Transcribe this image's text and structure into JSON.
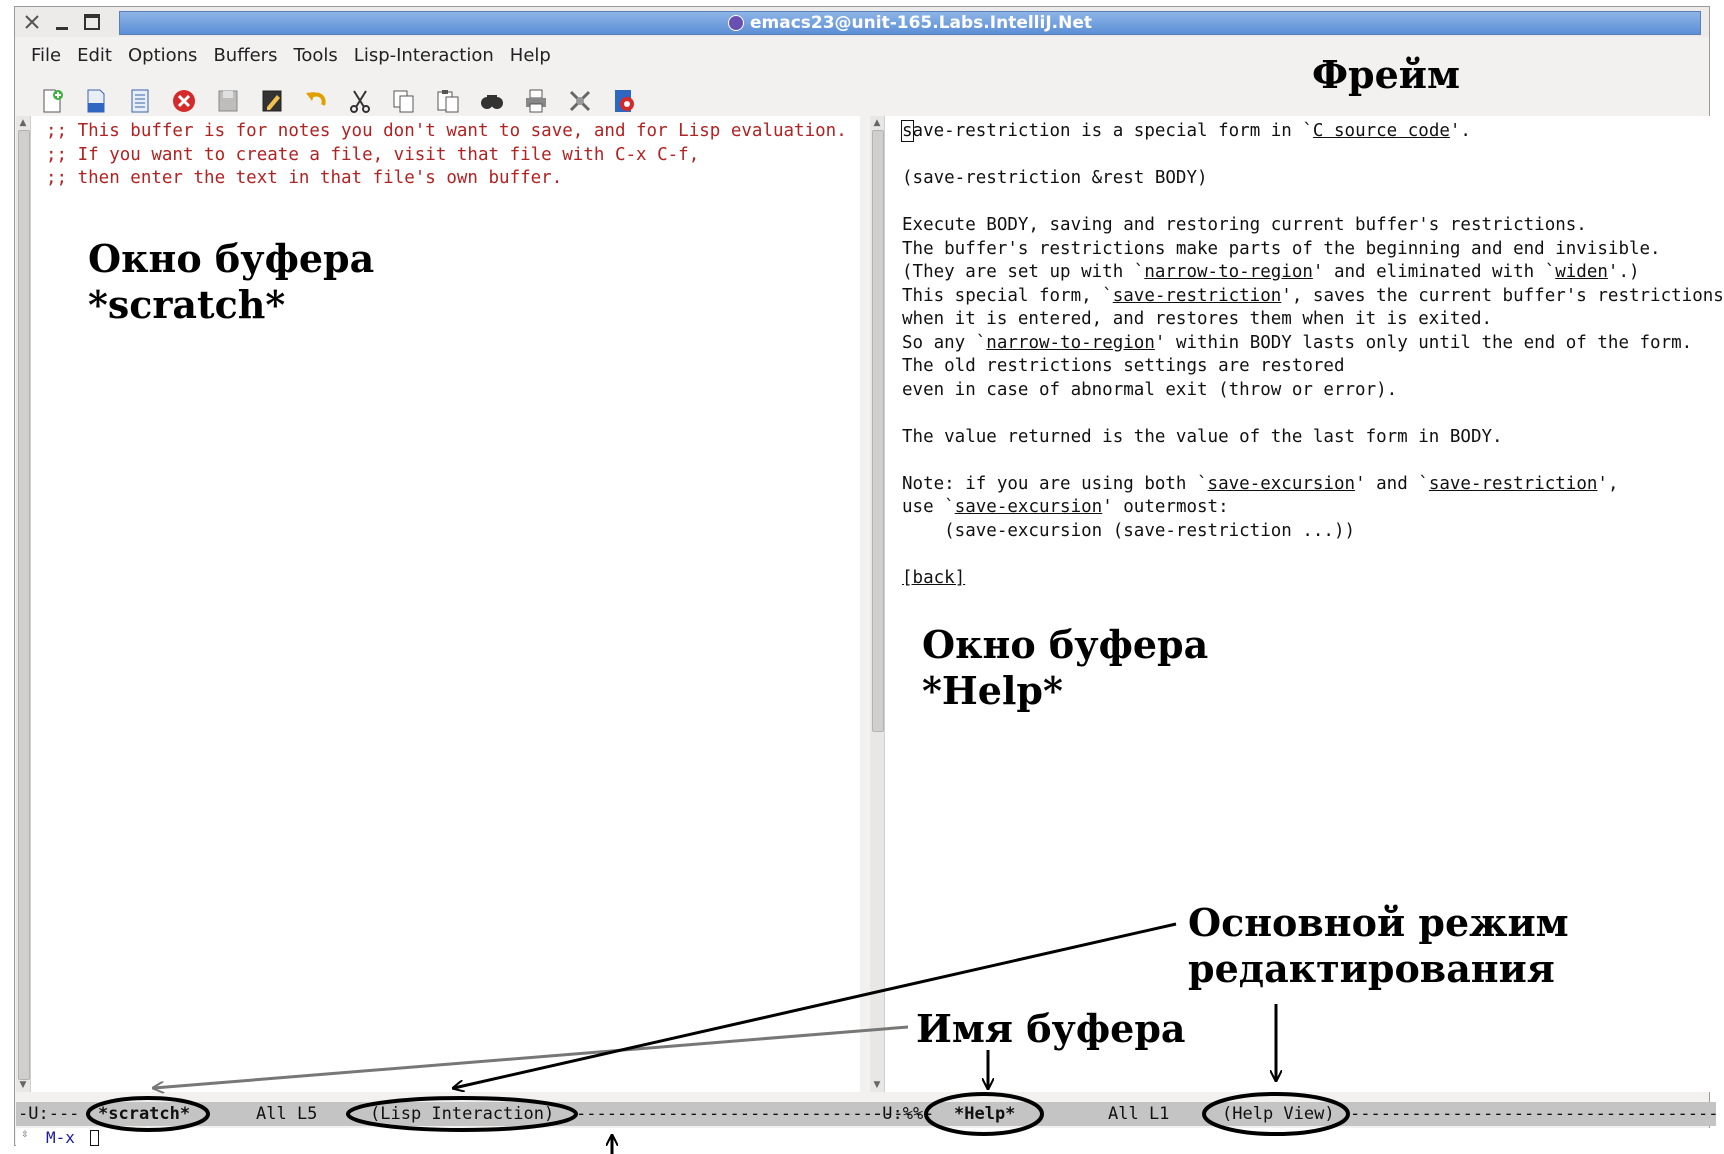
{
  "window": {
    "title": "emacs23@unit-165.Labs.IntelliJ.Net"
  },
  "menubar": {
    "items": [
      "File",
      "Edit",
      "Options",
      "Buffers",
      "Tools",
      "Lisp-Interaction",
      "Help"
    ]
  },
  "toolbar": {
    "icons": [
      "new-file-icon",
      "open-file-icon",
      "open-directory-icon",
      "close-buffer-icon",
      "save-icon",
      "save-as-icon",
      "undo-icon",
      "cut-icon",
      "copy-icon",
      "paste-icon",
      "search-icon",
      "print-icon",
      "preferences-icon",
      "info-icon"
    ]
  },
  "left_pane": {
    "lines": [
      ";; This buffer is for notes you don't want to save, and for Lisp evaluation.",
      ";; If you want to create a file, visit that file with C-x C-f,",
      ";; then enter the text in that file's own buffer."
    ]
  },
  "right_pane": {
    "l1_a": "ave-restriction is a special form in `",
    "l1_link": "C source code",
    "l1_b": "'.",
    "l1_cursor": "s",
    "sig": "(save-restriction &rest BODY)",
    "p1": "Execute BODY, saving and restoring current buffer's restrictions.",
    "p2": "The buffer's restrictions make parts of the beginning and end invisible.",
    "p3_a": "(They are set up with `",
    "p3_link1": "narrow-to-region",
    "p3_b": "' and eliminated with `",
    "p3_link2": "widen",
    "p3_c": "'.)",
    "p4_a": "This special form, `",
    "p4_link": "save-restriction",
    "p4_b": "', saves the current buffer's restrictions",
    "p5": "when it is entered, and restores them when it is exited.",
    "p6_a": "So any `",
    "p6_link": "narrow-to-region",
    "p6_b": "' within BODY lasts only until the end of the form.",
    "p7": "The old restrictions settings are restored",
    "p8": "even in case of abnormal exit (throw or error).",
    "p9": "The value returned is the value of the last form in BODY.",
    "n1_a": "Note: if you are using both `",
    "n1_link1": "save-excursion",
    "n1_b": "' and `",
    "n1_link2": "save-restriction",
    "n1_c": "',",
    "n2_a": "use `",
    "n2_link": "save-excursion",
    "n2_b": "' outermost:",
    "n3": "    (save-excursion (save-restriction ...))",
    "back": "[back]"
  },
  "modeline": {
    "left_status": "-U:---",
    "left_buffer": "*scratch*",
    "left_pos": "All L5",
    "left_mode": "(Lisp Interaction)",
    "left_dashes": "-----------------------------------",
    "right_status": "-U:%%-",
    "right_buffer": "*Help*",
    "right_pos": "All L1",
    "right_mode": "(Help View)",
    "right_dashes": "------------------------------------------------"
  },
  "minibuffer": {
    "prompt": "M-x"
  },
  "annotations": {
    "frame": "Фрейм",
    "scratch_window": "Окно буфера\n*scratch*",
    "help_window": "Окно буфера\n*Help*",
    "major_mode": "Основной режим\nредактирования",
    "buffer_name": "Имя буфера"
  }
}
